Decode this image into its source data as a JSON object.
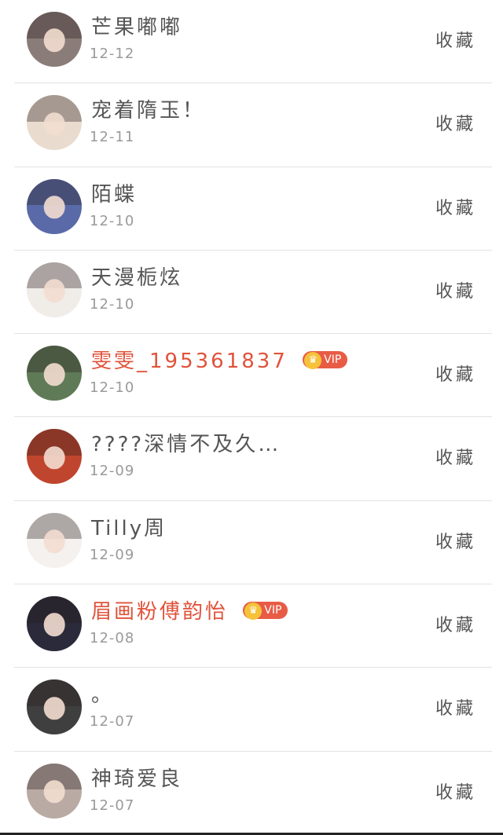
{
  "collect_label": "收藏",
  "users": [
    {
      "name": "芒果嘟嘟",
      "date": "12-12",
      "vip": false,
      "avatar_bg": "#8a7c78"
    },
    {
      "name": "宠着隋玉！",
      "date": "12-11",
      "vip": false,
      "avatar_bg": "#e9dccf"
    },
    {
      "name": "陌蝶",
      "date": "12-10",
      "vip": false,
      "avatar_bg": "#5a6aa8"
    },
    {
      "name": "天漫栀炫",
      "date": "12-10",
      "vip": false,
      "avatar_bg": "#f0ece8"
    },
    {
      "name": "雯雯_195361837",
      "date": "12-10",
      "vip": true,
      "vip_label": "VIP",
      "avatar_bg": "#5f7a56"
    },
    {
      "name": "????深情不及久…",
      "date": "12-09",
      "vip": false,
      "avatar_bg": "#c0452e"
    },
    {
      "name": "Tilly周",
      "date": "12-09",
      "vip": false,
      "avatar_bg": "#f4f1ee"
    },
    {
      "name": "眉画粉傅韵怡",
      "date": "12-08",
      "vip": true,
      "vip_label": "VIP",
      "avatar_bg": "#2a2a3a"
    },
    {
      "name": "。",
      "date": "12-07",
      "vip": false,
      "avatar_bg": "#3f3f3f"
    },
    {
      "name": "神琦爱良",
      "date": "12-07",
      "vip": false,
      "avatar_bg": "#b9aaa3"
    }
  ],
  "colors": {
    "vip_name": "#e0533b",
    "vip_badge": "#e85b45",
    "vip_crown": "#f5c23a",
    "divider": "#e3e3e3"
  }
}
